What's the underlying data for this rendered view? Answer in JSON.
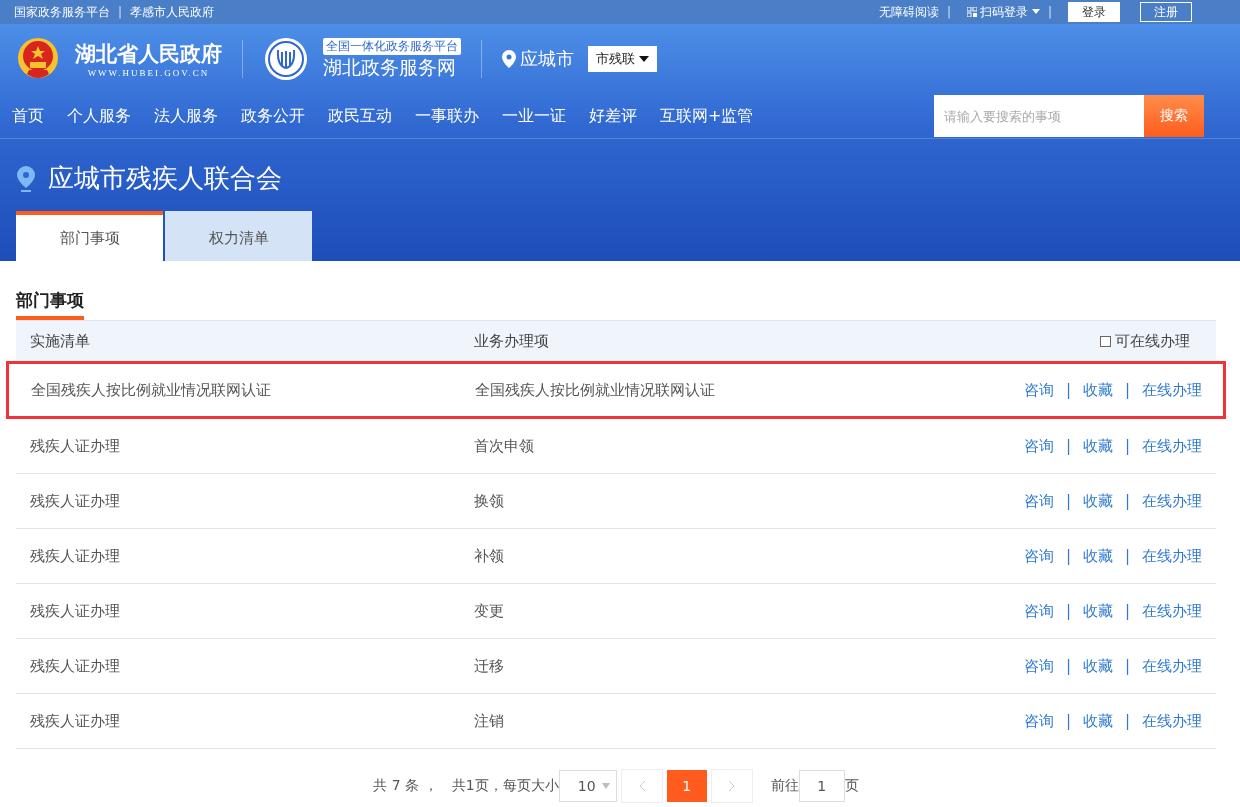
{
  "top_bar": {
    "left_links": [
      "国家政务服务平台",
      "孝感市人民政府"
    ],
    "right_links": [
      "无障碍阅读",
      "扫码登录"
    ],
    "separator": "|",
    "login": "登录",
    "register": "注册"
  },
  "header": {
    "gov_name": "湖北省人民政府",
    "gov_url": "WWW.HUBEI.GOV.CN",
    "platform_badge": "全国一体化政务服务平台",
    "platform_name": "湖北政务服务网",
    "city": "应城市",
    "dept_select": "市残联"
  },
  "nav": [
    "首页",
    "个人服务",
    "法人服务",
    "政务公开",
    "政民互动",
    "一事联办",
    "一业一证",
    "好差评",
    "互联网+监管"
  ],
  "search": {
    "placeholder": "请输入要搜索的事项",
    "button": "搜索"
  },
  "banner": {
    "title": "应城市残疾人联合会"
  },
  "tabs": [
    {
      "label": "部门事项",
      "selected": true
    },
    {
      "label": "权力清单",
      "selected": false
    }
  ],
  "section_title": "部门事项",
  "table": {
    "columns": [
      "实施清单",
      "业务办理项"
    ],
    "action_separator": "|",
    "online_filter": {
      "label": "可在线办理",
      "checked": false
    },
    "rows": [
      {
        "list": "全国残疾人按比例就业情况联网认证",
        "item": "全国残疾人按比例就业情况联网认证",
        "actions": [
          "咨询",
          "收藏",
          "在线办理"
        ],
        "highlighted": true
      },
      {
        "list": "残疾人证办理",
        "item": "首次申领",
        "actions": [
          "咨询",
          "收藏",
          "在线办理"
        ],
        "highlighted": false
      },
      {
        "list": "残疾人证办理",
        "item": "换领",
        "actions": [
          "咨询",
          "收藏",
          "在线办理"
        ],
        "highlighted": false
      },
      {
        "list": "残疾人证办理",
        "item": "补领",
        "actions": [
          "咨询",
          "收藏",
          "在线办理"
        ],
        "highlighted": false
      },
      {
        "list": "残疾人证办理",
        "item": "变更",
        "actions": [
          "咨询",
          "收藏",
          "在线办理"
        ],
        "highlighted": false
      },
      {
        "list": "残疾人证办理",
        "item": "迁移",
        "actions": [
          "咨询",
          "收藏",
          "在线办理"
        ],
        "highlighted": false
      },
      {
        "list": "残疾人证办理",
        "item": "注销",
        "actions": [
          "咨询",
          "收藏",
          "在线办理"
        ],
        "highlighted": false
      }
    ]
  },
  "pagination": {
    "total": "共 7 条 ，",
    "pages": "共1页，每页大小",
    "page_size": "10",
    "pages_list": [
      {
        "label": "1",
        "selected": true
      }
    ],
    "goto_prefix": "前往",
    "goto_value": "1",
    "goto_suffix": "页"
  }
}
